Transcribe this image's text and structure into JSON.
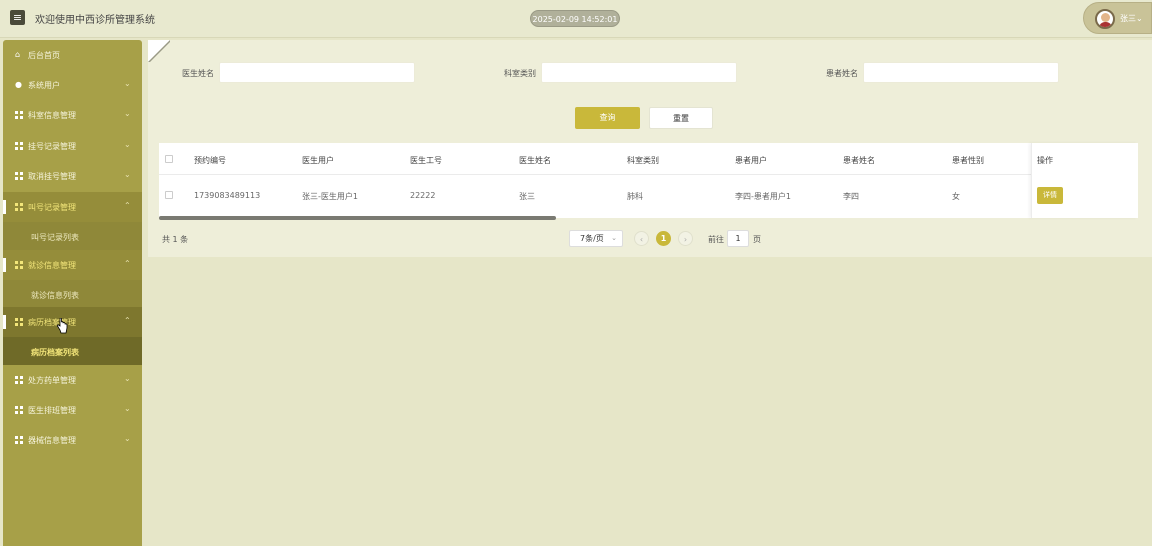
{
  "header": {
    "menu_icon": "menu-icon",
    "title": "欢迎使用中西诊所管理系统",
    "clock": "2025-02-09 14:52:01",
    "user_name": "张三",
    "user_chevron": "⌄"
  },
  "sidebar": {
    "items": [
      {
        "label": "后台首页",
        "icon": "home-icon"
      },
      {
        "label": "系统用户",
        "icon": "user-icon",
        "chevron": "⌄"
      },
      {
        "label": "科室信息管理",
        "icon": "grid-icon",
        "chevron": "⌄"
      },
      {
        "label": "挂号记录管理",
        "icon": "grid-icon",
        "chevron": "⌄"
      },
      {
        "label": "取消挂号管理",
        "icon": "grid-icon",
        "chevron": "⌄"
      },
      {
        "label": "叫号记录管理",
        "icon": "grid-icon",
        "chevron": "⌃"
      },
      {
        "label": "就诊信息管理",
        "icon": "grid-icon",
        "chevron": "⌃"
      },
      {
        "label": "病历档案管理",
        "icon": "grid-icon",
        "chevron": "⌃"
      },
      {
        "label": "处方药单管理",
        "icon": "grid-icon",
        "chevron": "⌄"
      },
      {
        "label": "医生排班管理",
        "icon": "grid-icon",
        "chevron": "⌄"
      },
      {
        "label": "器械信息管理",
        "icon": "grid-icon",
        "chevron": "⌄"
      }
    ],
    "sub_items": [
      {
        "label": "叫号记录列表"
      },
      {
        "label": "就诊信息列表"
      },
      {
        "label": "病历档案列表"
      }
    ]
  },
  "filters": {
    "doctor_name_label": "医生姓名",
    "department_label": "科室类别",
    "patient_name_label": "患者姓名",
    "doctor_name_value": "",
    "department_value": "",
    "patient_name_value": ""
  },
  "actions": {
    "search": "查询",
    "reset": "重置"
  },
  "table": {
    "columns": [
      "预约编号",
      "医生用户",
      "医生工号",
      "医生姓名",
      "科室类别",
      "患者用户",
      "患者姓名",
      "患者性别",
      "操作"
    ],
    "rows": [
      {
        "cells": [
          "1739083489113",
          "张三-医生用户1",
          "22222",
          "张三",
          "肺科",
          "李四-患者用户1",
          "李四",
          "女"
        ],
        "action": "详情"
      }
    ]
  },
  "pagination": {
    "total": "共 1 条",
    "page_size": "7条/页",
    "prev": "‹",
    "current_page": "1",
    "next": "›",
    "goto_label": "前往",
    "goto_value": "1",
    "goto_unit": "页"
  },
  "colors": {
    "accent": "#c9b83a",
    "sidebar": "#a7a048",
    "active_text": "#f3e67a"
  }
}
